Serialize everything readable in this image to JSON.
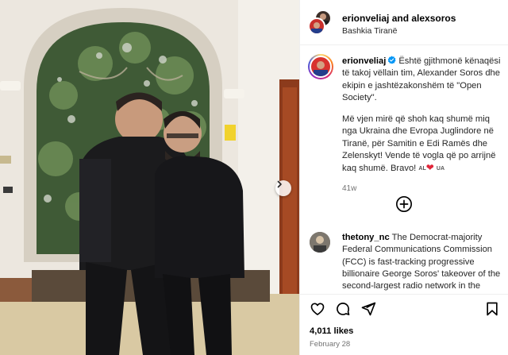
{
  "header": {
    "users": "erionveliaj and alexsoros",
    "location": "Bashkia Tiranë"
  },
  "caption": {
    "username": "erionveliaj",
    "line1": "Është gjithmonë kënaqësi të takoj vëllain tim, Alexander Soros dhe ekipin e jashtëzakonshëm të \"Open Society\".",
    "line2": "Më vjen mirë që shoh kaq shumë miq nga Ukraina dhe Evropa Juglindore në Tiranë, për Samitin e Edi Ramës dhe Zelenskyt! Vende të vogla që po arrijnë kaq shumë. Bravo!",
    "flag_left": "AL",
    "heart": "❤",
    "flag_right": "UA",
    "time_ago": "41w"
  },
  "comment": {
    "username": "thetony_nc",
    "text": "The Democrat-majority Federal Communications Commission (FCC) is fast-tracking progressive billionaire George Soros' takeover of the second-largest radio network in the"
  },
  "footer": {
    "likes": "4,011 likes",
    "date": "February 28"
  },
  "icons": {
    "verified": "verified-badge-icon",
    "add": "add-circle-icon",
    "like": "heart-icon",
    "comment": "comment-icon",
    "share": "share-icon",
    "save": "bookmark-icon",
    "next": "chevron-right-icon"
  },
  "colors": {
    "verified_blue": "#0095f6",
    "heart_red": "#e0263a",
    "secondary_text": "#737373"
  }
}
